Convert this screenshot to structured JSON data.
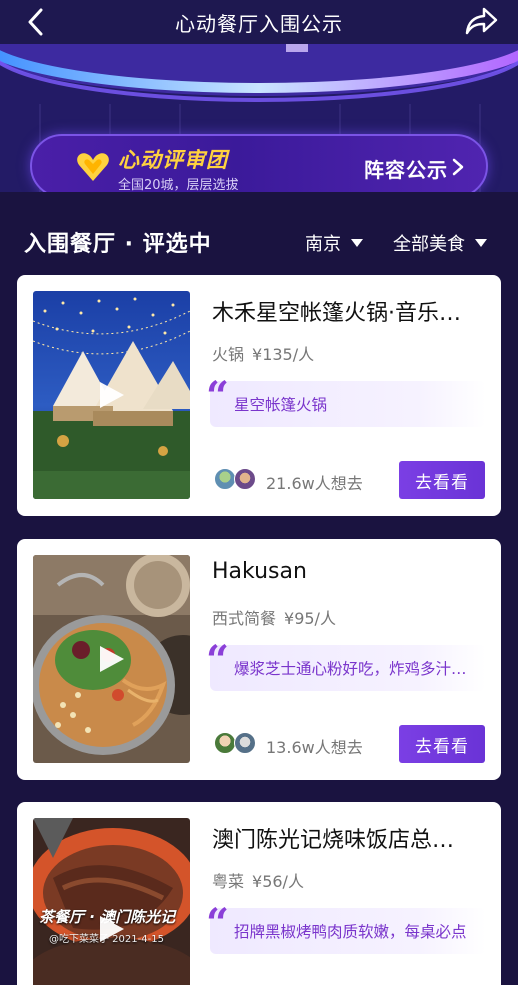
{
  "header": {
    "title": "心动餐厅入围公示",
    "back_icon": "chevron-left-icon",
    "share_icon": "share-arrow-icon"
  },
  "banner": {
    "title": "心动评审团",
    "subtitle": "全国20城，层层选拔",
    "link_label": "阵容公示",
    "heart_color": "#ffd23f"
  },
  "filters": {
    "section_title": "入围餐厅 · 评选中",
    "city": "南京",
    "cuisine": "全部美食"
  },
  "restaurants": [
    {
      "name": "木禾星空帐篷火锅·音乐…",
      "category": "火锅",
      "price": "¥135/人",
      "quote": "星空帐篷火锅",
      "want_count": "21.6w人想去",
      "button_label": "去看看"
    },
    {
      "name": "Hakusan",
      "category": "西式简餐",
      "price": "¥95/人",
      "quote": "爆浆芝士通心粉好吃，炸鸡多汁…",
      "want_count": "13.6w人想去",
      "button_label": "去看看"
    },
    {
      "name": "澳门陈光记烧味饭店总…",
      "category": "粤菜",
      "price": "¥56/人",
      "quote": "招牌黑椒烤鸭肉质软嫩，每桌必点",
      "thumb_caption": "茶餐厅 · 澳门陈光记",
      "thumb_sub": "@吃下菜菜子  2021-4-15"
    }
  ],
  "colors": {
    "background": "#1a1340",
    "accent_purple": "#7b3fe4",
    "quote_text": "#7a35cc"
  }
}
